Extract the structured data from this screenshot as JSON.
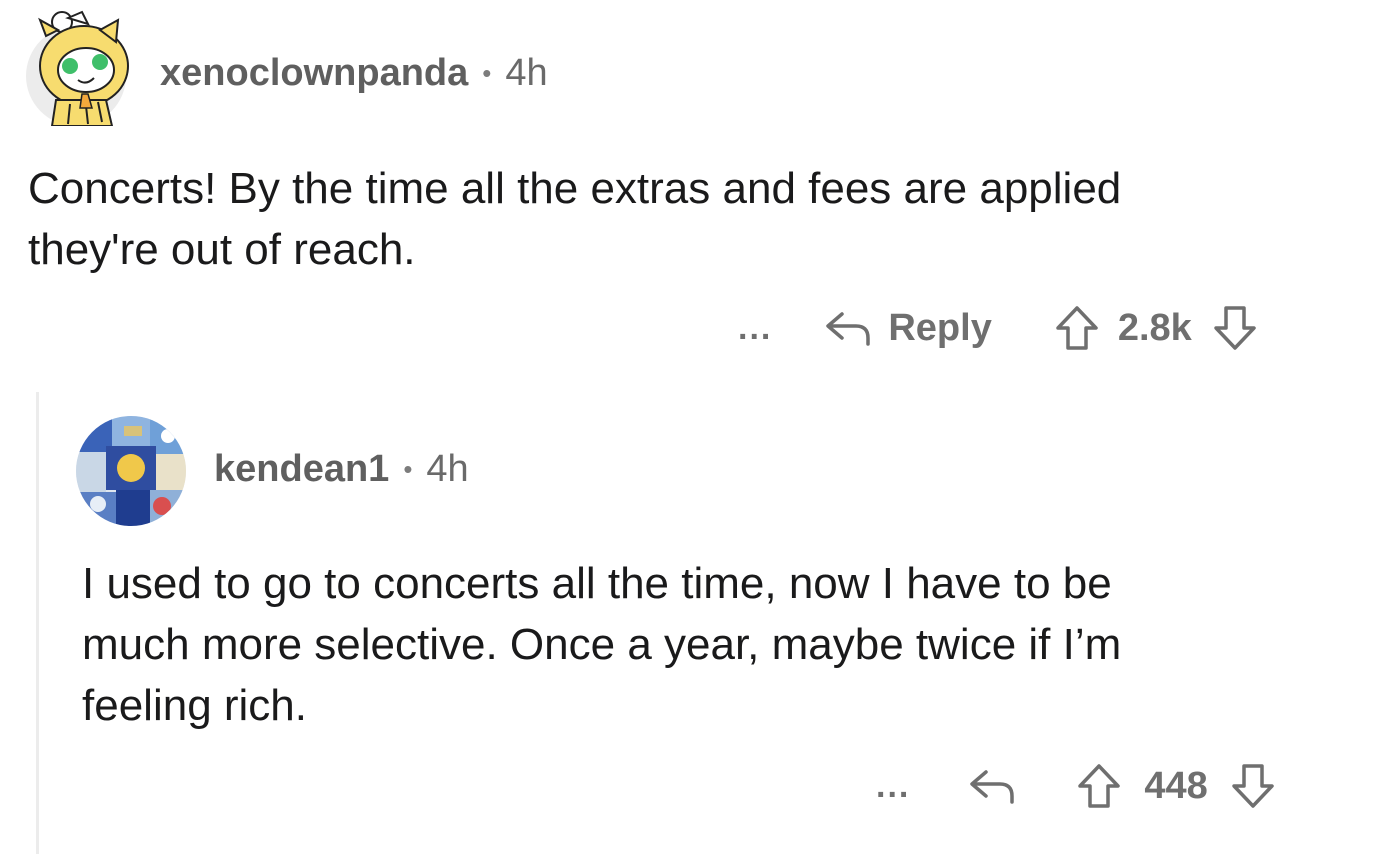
{
  "comments": [
    {
      "username": "xenoclownpanda",
      "separator": "•",
      "age": "4h",
      "text_lines": [
        "Concerts! By the time all the extras and fees are applied",
        "they're out of reach."
      ],
      "more_label": "...",
      "reply_label": "Reply",
      "score": "2.8k"
    },
    {
      "username": "kendean1",
      "separator": "•",
      "age": "4h",
      "text_lines": [
        "I used to go to concerts all the time, now I have to be",
        "much more selective. Once a year, maybe twice if I’m",
        "feeling rich."
      ],
      "more_label": "...",
      "score": "448"
    }
  ],
  "icons": {
    "reply": "reply-arrow-icon",
    "upvote": "upvote-arrow-icon",
    "downvote": "downvote-arrow-icon",
    "avatar_1": "snoo-avatar-icon",
    "avatar_2": "mosaic-avatar-icon"
  },
  "colors": {
    "text": "#1a1a1b",
    "meta": "#6a6a6a",
    "action": "#6f6f6f",
    "thread_line": "#ececec",
    "avatar_1_bg": "#ededed",
    "avatar_1_head": "#f7dc6f"
  }
}
